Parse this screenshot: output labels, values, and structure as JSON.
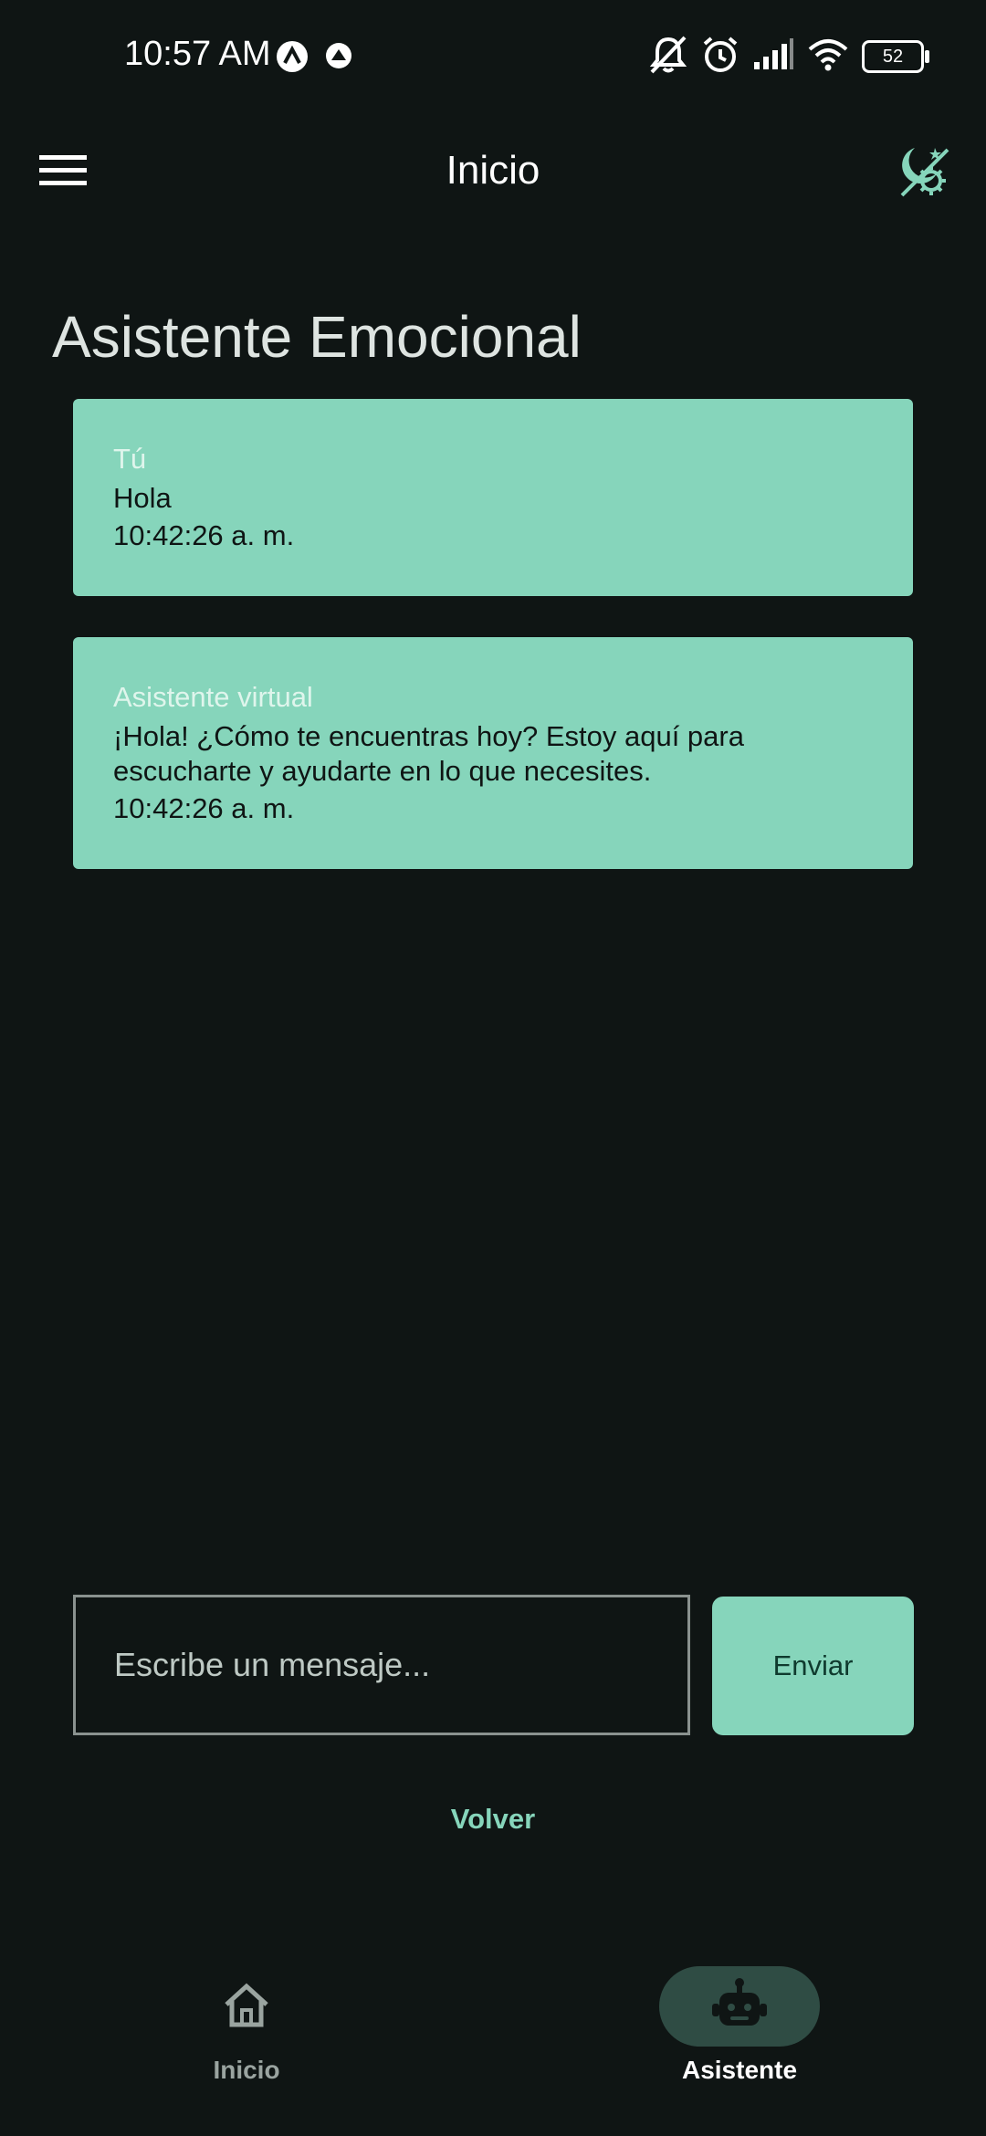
{
  "status_bar": {
    "time": "10:57 AM",
    "battery": "52",
    "icons": [
      "app-notification-icon",
      "app-notification-icon-2",
      "mute-icon",
      "alarm-icon",
      "signal-icon",
      "wifi-icon",
      "battery-icon"
    ]
  },
  "app_bar": {
    "title": "Inicio",
    "menu_icon": "hamburger-menu-icon",
    "theme_icon": "theme-toggle-icon"
  },
  "page": {
    "title": "Asistente Emocional"
  },
  "messages": [
    {
      "sender": "Tú",
      "text": "Hola",
      "time": "10:42:26 a. m."
    },
    {
      "sender": "Asistente virtual",
      "text": "¡Hola! ¿Cómo te encuentras hoy? Estoy aquí para escucharte y ayudarte en lo que necesites.",
      "time": "10:42:26 a. m."
    }
  ],
  "composer": {
    "placeholder": "Escribe un mensaje...",
    "value": "",
    "send_label": "Enviar"
  },
  "back_label": "Volver",
  "bottom_nav": {
    "items": [
      {
        "label": "Inicio",
        "icon": "home-icon",
        "active": false
      },
      {
        "label": "Asistente",
        "icon": "robot-icon",
        "active": true
      }
    ]
  },
  "colors": {
    "background": "#0f1514",
    "accent": "#86d5bb",
    "nav_active_pill": "#2f4c44"
  }
}
